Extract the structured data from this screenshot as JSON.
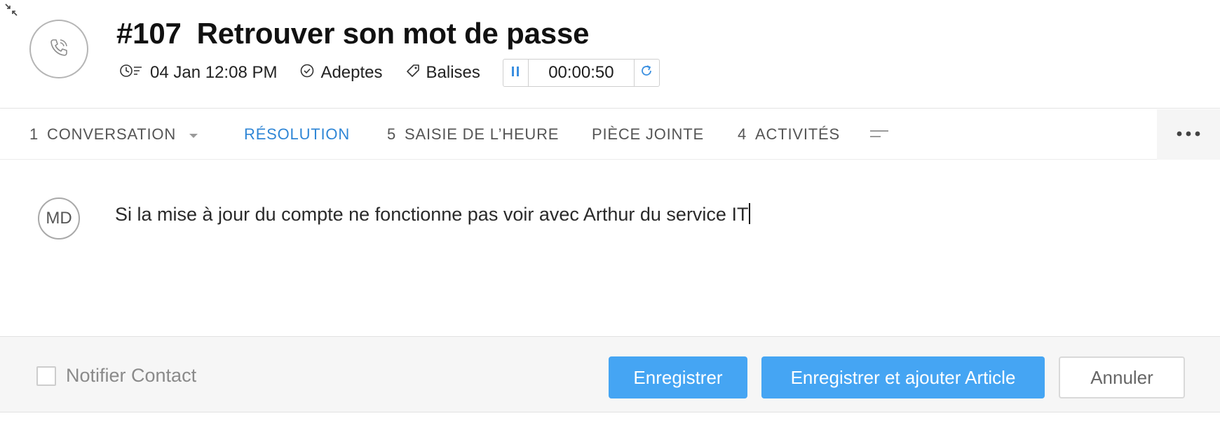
{
  "ticket": {
    "number": "#107",
    "title": "Retrouver son mot de passe",
    "datetime": "04 Jan 12:08 PM",
    "followers_label": "Adeptes",
    "tags_label": "Balises",
    "timer": "00:00:50"
  },
  "tabs": [
    {
      "count": "1",
      "label": "CONVERSATION",
      "active": false
    },
    {
      "count": "",
      "label": "RÉSOLUTION",
      "active": true
    },
    {
      "count": "5",
      "label": "SAISIE DE L’HEURE",
      "active": false
    },
    {
      "count": "",
      "label": "PIÈCE JOINTE",
      "active": false
    },
    {
      "count": "4",
      "label": "ACTIVITÉS",
      "active": false
    }
  ],
  "resolution": {
    "avatar_initials": "MD",
    "text": "Si la mise à jour du compte ne fonctionne pas voir avec Arthur du service IT"
  },
  "footer": {
    "notify_label": "Notifier Contact",
    "save_label": "Enregistrer",
    "save_add_article_label": "Enregistrer et ajouter Article",
    "cancel_label": "Annuler"
  },
  "colors": {
    "accent": "#2f86d6",
    "primary_button": "#45a5f3"
  }
}
